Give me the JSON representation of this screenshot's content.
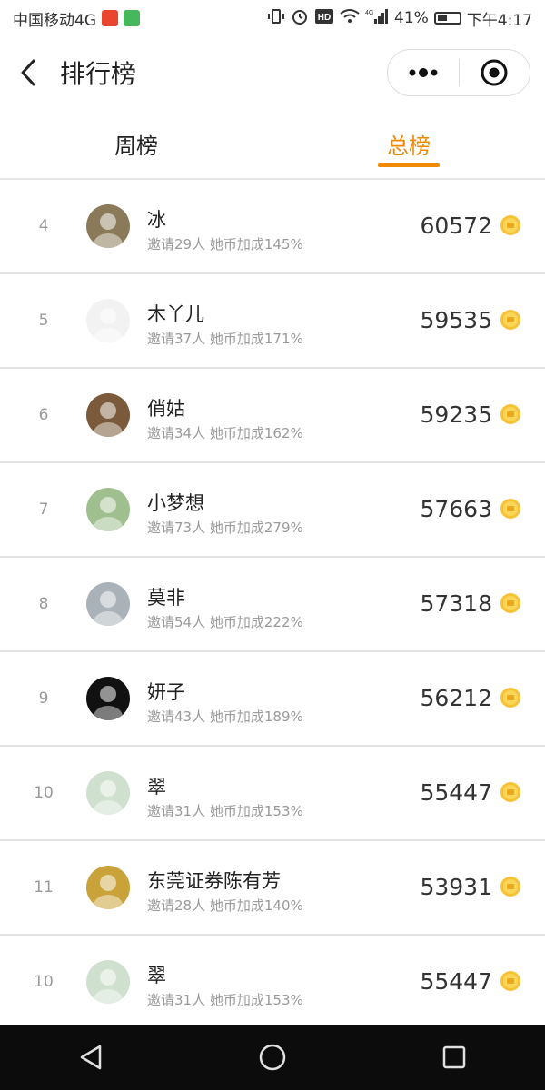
{
  "status_bar": {
    "carrier": "中国移动4G",
    "battery": "41%",
    "time": "下午4:17",
    "network": "4G"
  },
  "header": {
    "title": "排行榜"
  },
  "tabs": [
    {
      "label": "周榜",
      "active": false
    },
    {
      "label": "总榜",
      "active": true
    }
  ],
  "accent_color": "#f08a00",
  "rows": [
    {
      "rank": "4",
      "name": "冰",
      "invite": "邀请29人 她币加成145%",
      "score": "60572",
      "avatar_color": "#8a7a5a"
    },
    {
      "rank": "5",
      "name": "木丫儿",
      "invite": "邀请37人 她币加成171%",
      "score": "59535",
      "avatar_color": "#f2f2f2"
    },
    {
      "rank": "6",
      "name": "俏姑",
      "invite": "邀请34人 她币加成162%",
      "score": "59235",
      "avatar_color": "#7a5a3a"
    },
    {
      "rank": "7",
      "name": "小梦想",
      "invite": "邀请73人 她币加成279%",
      "score": "57663",
      "avatar_color": "#9fbf8f"
    },
    {
      "rank": "8",
      "name": "莫非",
      "invite": "邀请54人 她币加成222%",
      "score": "57318",
      "avatar_color": "#a9b2b8"
    },
    {
      "rank": "9",
      "name": "妍子",
      "invite": "邀请43人 她币加成189%",
      "score": "56212",
      "avatar_color": "#111111"
    },
    {
      "rank": "10",
      "name": "翠",
      "invite": "邀请31人 她币加成153%",
      "score": "55447",
      "avatar_color": "#cfe0cf"
    },
    {
      "rank": "11",
      "name": "东莞证券陈有芳",
      "invite": "邀请28人 她币加成140%",
      "score": "53931",
      "avatar_color": "#c9a23a"
    },
    {
      "rank": "10",
      "name": "翠",
      "invite": "邀请31人 她币加成153%",
      "score": "55447",
      "avatar_color": "#cfe0cf"
    }
  ]
}
